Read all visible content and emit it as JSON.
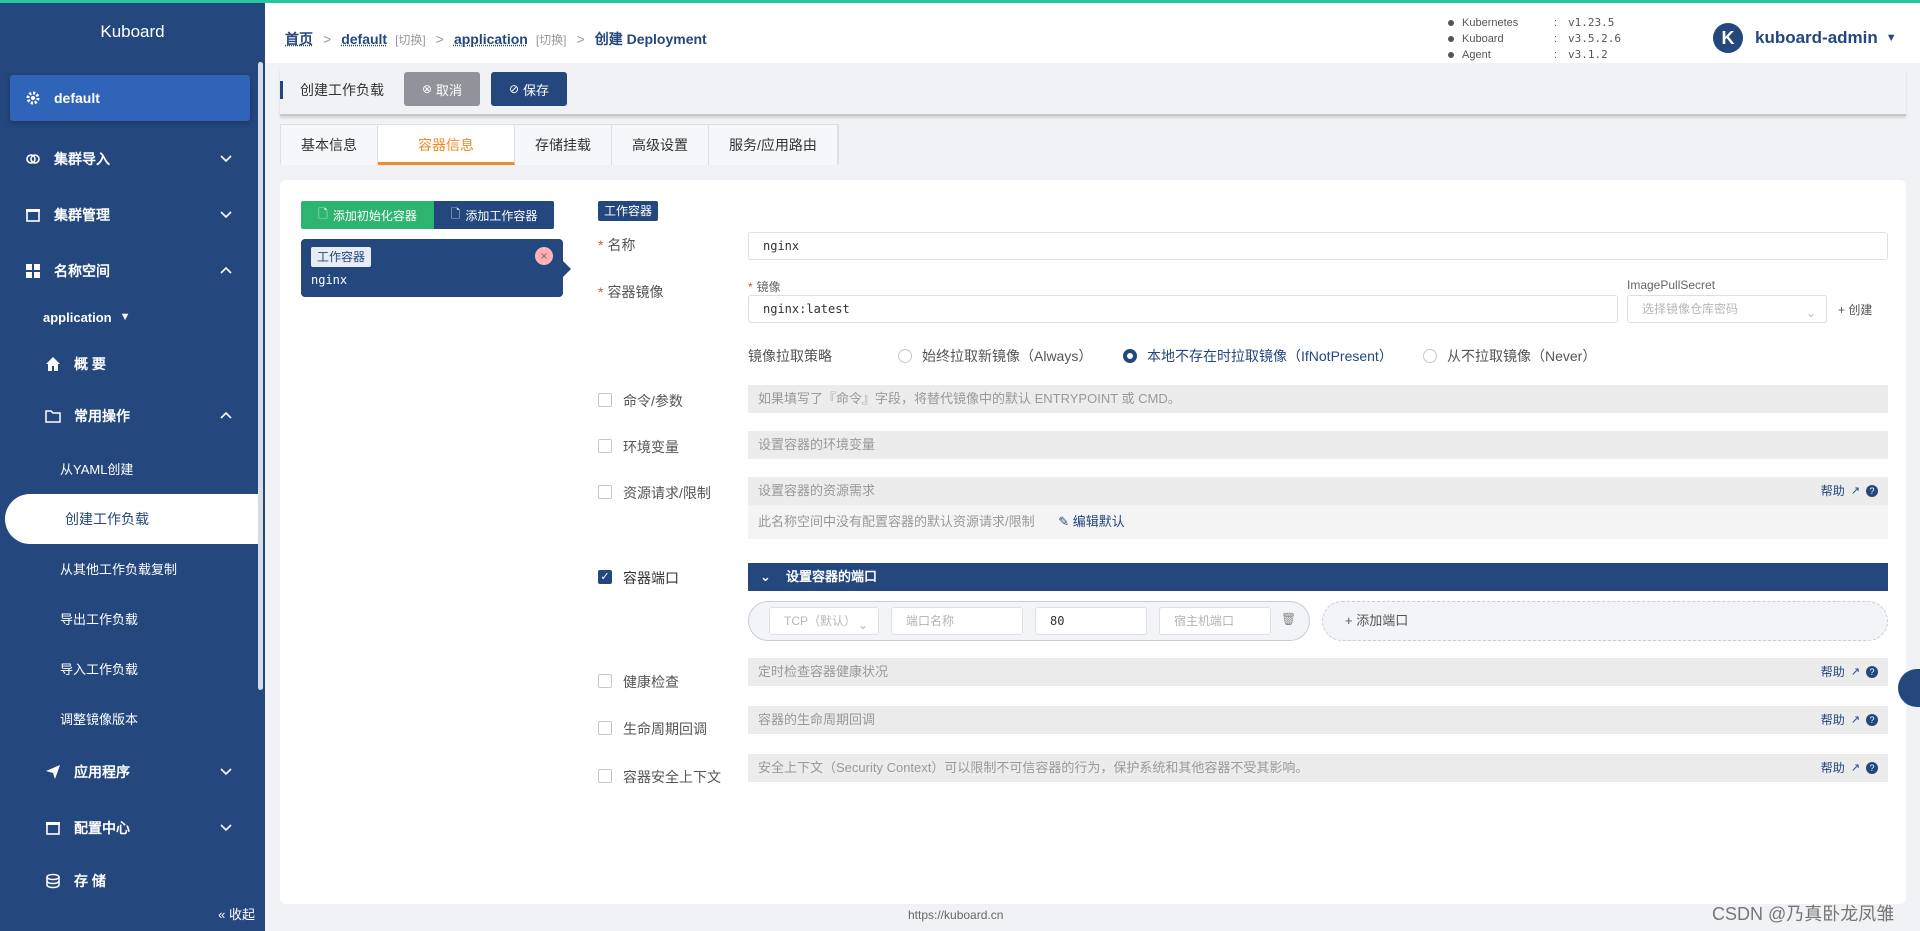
{
  "sidebar": {
    "brand": "Kuboard",
    "namespace": "default",
    "items": {
      "cluster_import": "集群导入",
      "cluster_manage": "集群管理",
      "namespace": "名称空间"
    },
    "app_ns": "application",
    "overview": "概 要",
    "common_ops": "常用操作",
    "sub": [
      "从YAML创建",
      "创建工作负载",
      "从其他工作负载复制",
      "导出工作负载",
      "导入工作负载",
      "调整镜像版本"
    ],
    "apps": "应用程序",
    "config": "配置中心",
    "storage": "存 储",
    "collapse": "« 收起"
  },
  "breadcrumb": {
    "home": "首页",
    "cluster": "default",
    "cluster_switch": "[切换]",
    "namespace": "application",
    "namespace_switch": "[切换]",
    "current": "创建 Deployment"
  },
  "versions": [
    {
      "name": "Kubernetes",
      "value": "v1.23.5"
    },
    {
      "name": "Kuboard",
      "value": "v3.5.2.6"
    },
    {
      "name": "Agent",
      "value": "v3.1.2"
    }
  ],
  "user": {
    "avatar": "K",
    "name": "kuboard-admin"
  },
  "toolbar": {
    "title": "创建工作负载",
    "cancel": "取消",
    "save": "保存"
  },
  "tabs": [
    "基本信息",
    "容器信息",
    "存储挂载",
    "高级设置",
    "服务/应用路由"
  ],
  "containers": {
    "add_init": "添加初始化容器",
    "add_work": "添加工作容器",
    "card_tag": "工作容器",
    "card_name": "nginx"
  },
  "form": {
    "section_tag": "工作容器",
    "name_label": "名称",
    "name_value": "nginx",
    "image_label": "容器镜像",
    "image_sub_label": "镜像",
    "image_value": "nginx:latest",
    "pull_secret_label": "ImagePullSecret",
    "pull_secret_placeholder": "选择镜像仓库密码",
    "create_link": "+ 创建",
    "pull_policy_label": "镜像拉取策略",
    "pull_policy_options": [
      "始终拉取新镜像（Always）",
      "本地不存在时拉取镜像（IfNotPresent）",
      "从不拉取镜像（Never）"
    ],
    "pull_policy_selected": 1,
    "cmd_label": "命令/参数",
    "cmd_hint": "如果填写了『命令』字段，将替代镜像中的默认 ENTRYPOINT 或 CMD。",
    "env_label": "环境变量",
    "env_hint": "设置容器的环境变量",
    "res_label": "资源请求/限制",
    "res_hint": "设置容器的资源需求",
    "res_note": "此名称空间中没有配置容器的默认资源请求/限制",
    "res_edit": "编辑默认",
    "help": "帮助",
    "ports_label": "容器端口",
    "ports_head": "设置容器的端口",
    "port_protocol": "TCP（默认）",
    "port_name_placeholder": "端口名称",
    "port_value": "80",
    "host_port_placeholder": "宿主机端口",
    "add_port": "+ 添加端口",
    "health_label": "健康检查",
    "health_hint": "定时检查容器健康状况",
    "lifecycle_label": "生命周期回调",
    "lifecycle_hint": "容器的生命周期回调",
    "security_label": "容器安全上下文",
    "security_hint": "安全上下文（Security Context）可以限制不可信容器的行为，保护系统和其他容器不受其影响。"
  },
  "footer": "https://kuboard.cn",
  "watermark": "CSDN @乃真卧龙凤雏"
}
